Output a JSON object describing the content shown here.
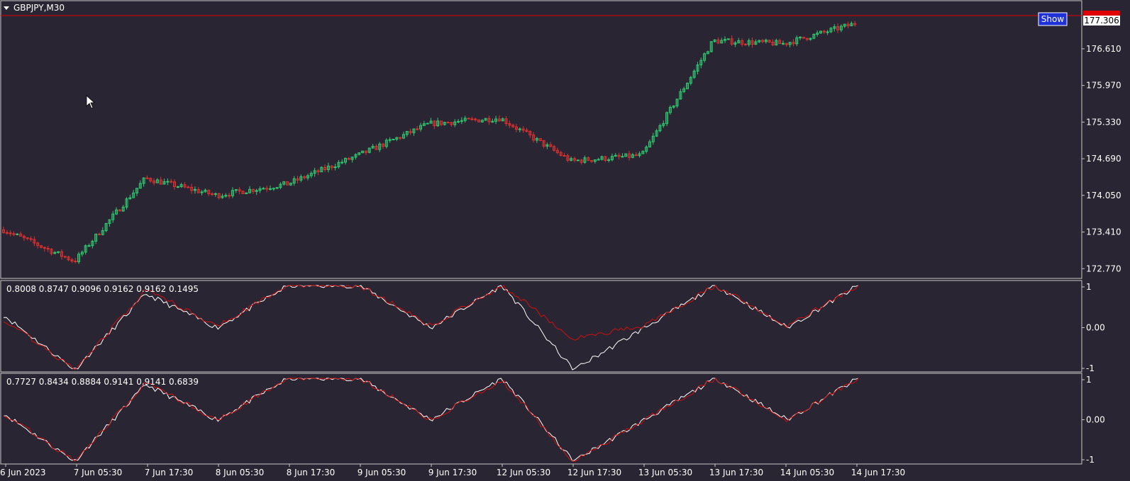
{
  "window": {
    "symbol_label": "GBPJPY,M30",
    "show_button": "Show"
  },
  "colors": {
    "background": "#2a2532",
    "frame": "#c8c8c8",
    "text": "#ffffff",
    "bull": "#2ecc71",
    "bear": "#e03030",
    "line_white": "#ffffff",
    "line_red": "#d01010",
    "price_line": "#e00000",
    "show_btn_bg": "#1e32d8"
  },
  "price_axis": {
    "labels": [
      "176.610",
      "175.970",
      "175.330",
      "174.690",
      "174.050",
      "173.410",
      "172.770"
    ],
    "current_price": "177.306"
  },
  "indicator1": {
    "label": "0.8008 0.8747 0.9096 0.9162 0.9162 0.1495",
    "axis_labels": [
      "1",
      "0.00",
      "-1"
    ]
  },
  "indicator2": {
    "label": "0.7727 0.8434 0.8884 0.9141 0.9141 0.6839",
    "axis_labels": [
      "1",
      "0.00",
      "-1"
    ]
  },
  "time_axis": {
    "labels": [
      "6 Jun 2023",
      "7 Jun 05:30",
      "7 Jun 17:30",
      "8 Jun 05:30",
      "8 Jun 17:30",
      "9 Jun 05:30",
      "9 Jun 17:30",
      "12 Jun 05:30",
      "12 Jun 17:30",
      "13 Jun 05:30",
      "13 Jun 17:30",
      "14 Jun 05:30",
      "14 Jun 17:30"
    ]
  },
  "chart_data": [
    {
      "type": "line",
      "ylabel": "",
      "ylim": [
        172.6,
        177.45
      ],
      "x": [
        "6 Jun 2023",
        "7 Jun 05:30",
        "7 Jun 17:30",
        "8 Jun 05:30",
        "8 Jun 17:30",
        "9 Jun 05:30",
        "9 Jun 17:30",
        "12 Jun 05:30",
        "12 Jun 17:30",
        "13 Jun 05:30",
        "13 Jun 17:30",
        "14 Jun 05:30",
        "14 Jun 17:30"
      ],
      "series": [
        {
          "values": [
            173.45,
            172.9,
            174.35,
            174.05,
            174.25,
            174.75,
            175.3,
            175.4,
            174.65,
            174.75,
            176.75,
            176.7,
            177.05
          ]
        }
      ]
    },
    {
      "type": "line",
      "ylim": [
        -1,
        1
      ],
      "series": [
        {
          "values": [
            0.2,
            -1.0,
            0.9,
            0.05,
            1.0,
            1.0,
            0.05,
            1.0,
            -0.25,
            0.05,
            1.0,
            0.05,
            1.0
          ]
        },
        {
          "values": [
            0.3,
            -1.0,
            0.8,
            0.0,
            1.0,
            1.0,
            0.0,
            1.0,
            -1.0,
            0.0,
            1.0,
            0.0,
            1.0
          ]
        }
      ]
    },
    {
      "type": "line",
      "ylim": [
        -1,
        1
      ],
      "series": [
        {
          "values": [
            0.15,
            -1.0,
            0.9,
            0.0,
            1.0,
            1.0,
            0.0,
            0.95,
            -1.0,
            0.0,
            1.0,
            0.0,
            1.0
          ]
        },
        {
          "values": [
            0.15,
            -1.0,
            0.85,
            0.0,
            1.0,
            1.0,
            0.0,
            1.0,
            -1.0,
            0.0,
            1.0,
            0.0,
            1.0
          ]
        }
      ]
    }
  ]
}
